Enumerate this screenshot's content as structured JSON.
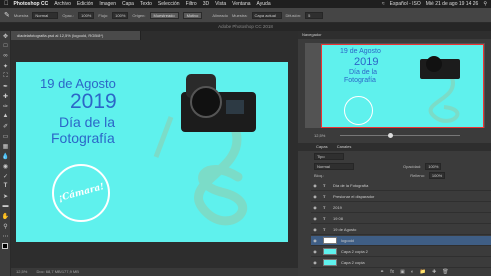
{
  "menubar": {
    "apple": "",
    "app": "Photoshop CC",
    "items": [
      "Archivo",
      "Edición",
      "Imagen",
      "Capa",
      "Texto",
      "Selección",
      "Filtro",
      "3D",
      "Vista",
      "Ventana",
      "Ayuda"
    ],
    "lang": "Español - ISO",
    "datetime": "Mié 21 de ago 19 14 26"
  },
  "options": {
    "sample_label": "Muestra",
    "mode": "Normal",
    "opacity_label": "Opac.:",
    "opacity": "100%",
    "flow_label": "Flujo:",
    "flow": "100%",
    "source_label": "Origen:",
    "source_value": "Muestreado",
    "pattern_label": "Motivo",
    "aligned_label": "Alineado",
    "sample_layer_label": "Muestra:",
    "sample_layer": "Capa actual",
    "diffusion_label": "Difusión:",
    "diffusion": "5"
  },
  "app_title": "Adobe Photoshop CC 2018",
  "doc": {
    "tab": "diadelafotografia.psd al 12,5% (logoold, RGB/8*)",
    "status": "12,5%",
    "doc_size": "Doc: 68,7 MB/177,9 MB"
  },
  "canvas": {
    "date": "19 de Agosto",
    "year": "2019",
    "line1": "Día de la",
    "line2": "Fotografía",
    "stamp": "¡Cámara!"
  },
  "panels": {
    "navigator": "Navegador",
    "nav_zoom": "12,5%",
    "layers_tab": "Capas",
    "channels_tab": "Canales",
    "kind": "Tipo",
    "blend": "Normal",
    "opacity_label": "Opacidad:",
    "opacity": "100%",
    "lock_label": "Bloq.:",
    "fill_label": "Relleno:",
    "fill": "100%"
  },
  "layers": [
    "Día de la Fotografía",
    "Presionar el disparador",
    "2019",
    "19 08",
    "19 de Agosto",
    "logoold",
    "Capa 2 copia 2",
    "Capa 2 copia"
  ]
}
